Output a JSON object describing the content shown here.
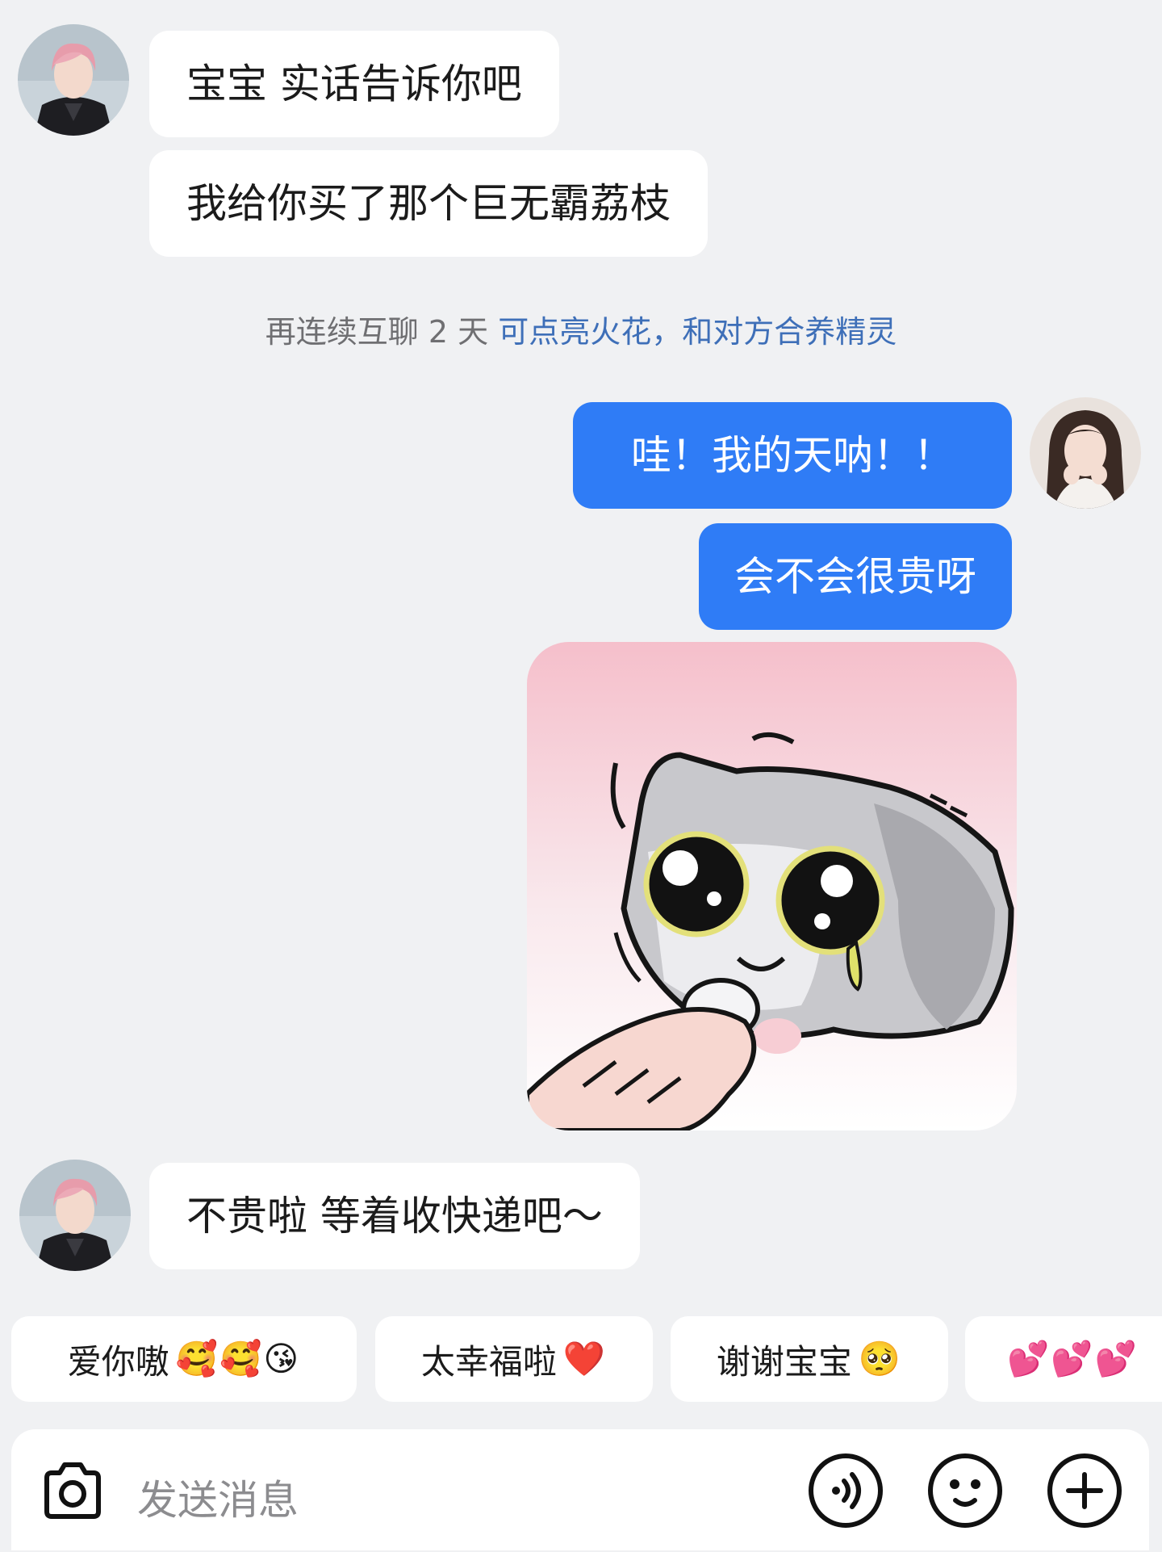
{
  "messages": [
    {
      "sender": "other",
      "text": "宝宝 实话告诉你吧"
    },
    {
      "sender": "other",
      "text": "我给你买了那个巨无霸荔枝"
    },
    {
      "sender": "me",
      "text": "哇！我的天呐！！"
    },
    {
      "sender": "me",
      "text": "会不会很贵呀"
    },
    {
      "sender": "other",
      "text": "不贵啦 等着收快递吧～"
    }
  ],
  "hint": {
    "gray_text": "再连续互聊 2 天 ",
    "blue_text": "可点亮火花，和对方合养精灵"
  },
  "sticker": {
    "icon": "crying-cat-sticker"
  },
  "quick_replies": [
    {
      "label": "爱你嗷",
      "emoji": "🥰🥰😘"
    },
    {
      "label": "太幸福啦",
      "emoji": "❤️"
    },
    {
      "label": "谢谢宝宝",
      "emoji": "🥺"
    },
    {
      "label": "",
      "emoji": "💕💕💕"
    }
  ],
  "input": {
    "placeholder": "发送消息"
  },
  "toolbar": {
    "camera_icon": "camera-icon",
    "voice_icon": "voice-icon",
    "emoji_icon": "emoji-icon",
    "plus_icon": "plus-icon"
  },
  "colors": {
    "background": "#f0f1f3",
    "my_bubble": "#2f7cf6",
    "their_bubble": "#ffffff",
    "hint_blue": "#3e6fb8"
  }
}
